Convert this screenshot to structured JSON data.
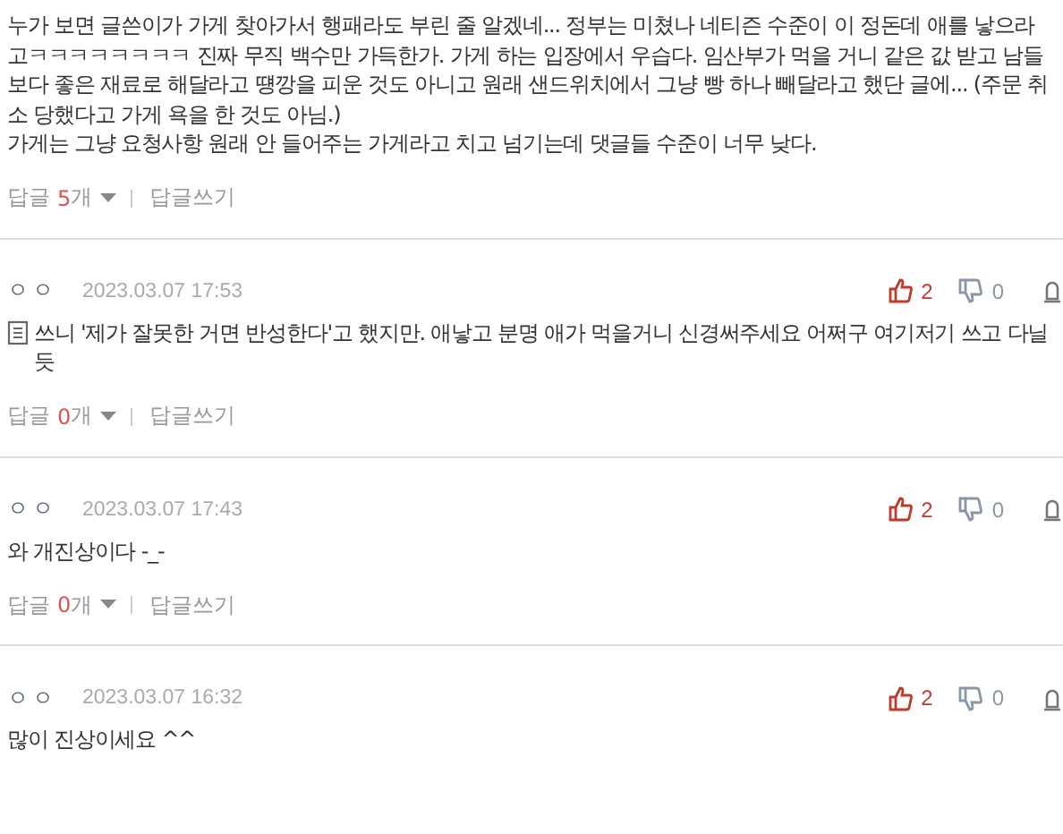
{
  "comments": [
    {
      "has_memo_icon": false,
      "paragraphs": [
        "누가 보면 글쓴이가 가게 찾아가서 행패라도 부린 줄 알겠네... 정부는 미쳤나 네티즌 수준이 이 정돈데 애를 낳으라고ㅋㅋㅋㅋㅋㅋㅋㅋ 진짜 무직 백수만 가득한가. 가게 하는 입장에서 우습다. 임산부가 먹을 거니 같은 값 받고 남들보다 좋은 재료로 해달라고 떙깡을 피운 것도 아니고 원래 샌드위치에서 그냥 빵 하나 빼달라고 했단 글에... (주문 취소 당했다고 가게 욕을 한 것도 아님.)",
        "가게는 그냥 요청사항 원래 안 들어주는 가게라고 치고 넘기는데 댓글들 수준이 너무 낮다."
      ],
      "reply_label": "답글",
      "reply_count": "5",
      "reply_unit": "개",
      "write_reply": "답글쓰기"
    },
    {
      "author": "ㅇㅇ",
      "date": "2023.03.07 17:53",
      "likes": "2",
      "dislikes": "0",
      "has_memo_icon": true,
      "paragraphs": [
        "쓰니 '제가 잘못한 거면 반성한다'고 했지만. 애낳고 분명 애가 먹을거니 신경써주세요 어쩌구 여기저기 쓰고 다닐듯"
      ],
      "reply_label": "답글",
      "reply_count": "0",
      "reply_unit": "개",
      "write_reply": "답글쓰기"
    },
    {
      "author": "ㅇㅇ",
      "date": "2023.03.07 17:43",
      "likes": "2",
      "dislikes": "0",
      "has_memo_icon": false,
      "paragraphs": [
        "와 개진상이다 -_-"
      ],
      "reply_label": "답글",
      "reply_count": "0",
      "reply_unit": "개",
      "write_reply": "답글쓰기"
    },
    {
      "author": "ㅇㅇ",
      "date": "2023.03.07 16:32",
      "likes": "2",
      "dislikes": "0",
      "has_memo_icon": false,
      "paragraphs": [
        "많이 진상이세요 ^^"
      ]
    }
  ]
}
